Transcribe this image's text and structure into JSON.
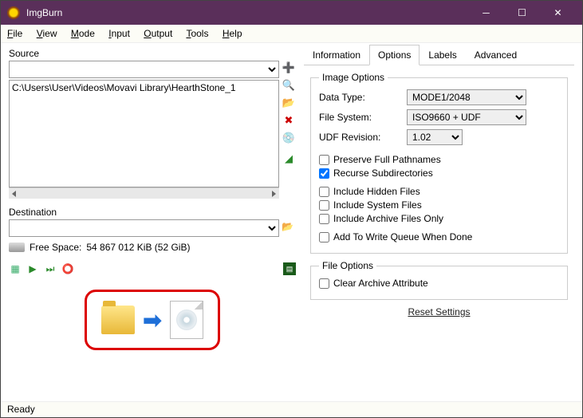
{
  "window": {
    "title": "ImgBurn"
  },
  "menu": {
    "file": "File",
    "view": "View",
    "mode": "Mode",
    "input": "Input",
    "output": "Output",
    "tools": "Tools",
    "help": "Help"
  },
  "source": {
    "label": "Source",
    "items": [
      "C:\\Users\\User\\Videos\\Movavi Library\\HearthStone_1"
    ]
  },
  "destination": {
    "label": "Destination"
  },
  "free_space": {
    "label": "Free Space:",
    "value": "54 867 012 KiB  (52 GiB)"
  },
  "tabs": {
    "information": "Information",
    "options": "Options",
    "labels": "Labels",
    "advanced": "Advanced"
  },
  "image_options": {
    "legend": "Image Options",
    "data_type_label": "Data Type:",
    "data_type_value": "MODE1/2048",
    "file_system_label": "File System:",
    "file_system_value": "ISO9660 + UDF",
    "udf_rev_label": "UDF Revision:",
    "udf_rev_value": "1.02",
    "preserve": "Preserve Full Pathnames",
    "preserve_checked": false,
    "recurse": "Recurse Subdirectories",
    "recurse_checked": true,
    "hidden": "Include Hidden Files",
    "hidden_checked": false,
    "system": "Include System Files",
    "system_checked": false,
    "archive_only": "Include Archive Files Only",
    "archive_only_checked": false,
    "queue": "Add To Write Queue When Done",
    "queue_checked": false
  },
  "file_options": {
    "legend": "File Options",
    "clear": "Clear Archive Attribute",
    "clear_checked": false
  },
  "reset": "Reset Settings",
  "status": "Ready"
}
